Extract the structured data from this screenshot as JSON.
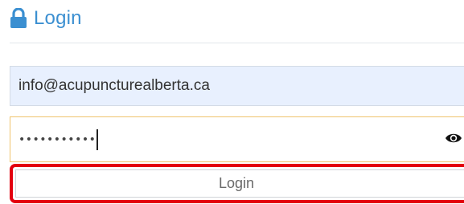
{
  "header": {
    "icon": "lock-icon",
    "title": "Login"
  },
  "form": {
    "email_value": "info@acupuncturealberta.ca",
    "password_mask": "•••••••••••",
    "show_password_icon": "eye-icon",
    "submit_label": "Login"
  },
  "colors": {
    "accent": "#3b8fd1",
    "email_bg": "#e8f0fe",
    "password_border": "#f0c46c",
    "highlight": "#e3000f"
  }
}
